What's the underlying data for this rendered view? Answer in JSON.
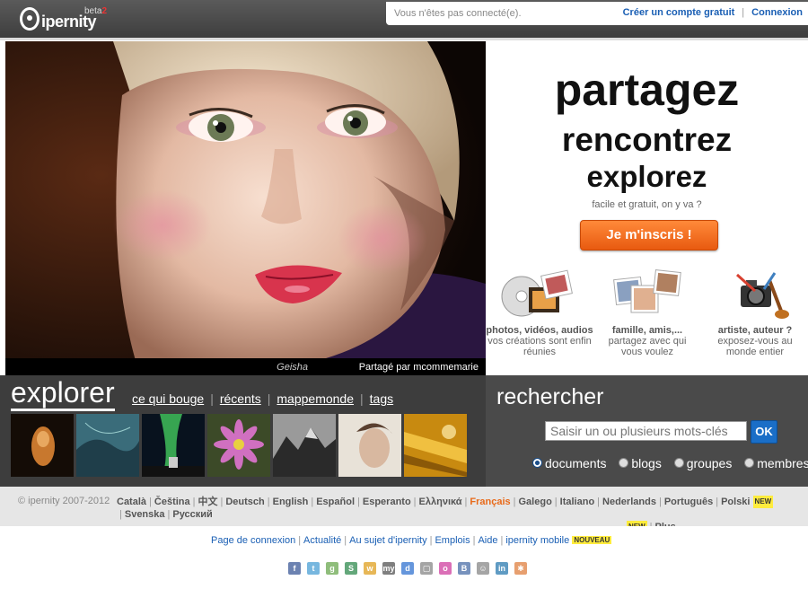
{
  "header": {
    "logo_text": "ipernity",
    "beta_text": "beta",
    "beta_num": "2",
    "status": "Vous n'êtes pas connecté(e).",
    "create_account": "Créer un compte gratuit",
    "separator": "|",
    "login": "Connexion"
  },
  "hero": {
    "photo_title": "Geisha",
    "shared_by": "Partagé par mcommemarie"
  },
  "promo": {
    "line1": "partagez",
    "line2": "rencontrez",
    "line3": "explorez",
    "tagline": "facile et gratuit, on y va ?",
    "signup_button": "Je m'inscris !",
    "features": [
      {
        "title": "photos, vidéos, audios",
        "desc1": "vos créations sont enfin",
        "desc2": "réunies"
      },
      {
        "title": "famille, amis,...",
        "desc1": "partagez avec qui",
        "desc2": "vous voulez"
      },
      {
        "title": "artiste, auteur ?",
        "desc1": "exposez-vous au",
        "desc2": "monde entier"
      }
    ]
  },
  "explorer": {
    "title": "explorer",
    "links": [
      "ce qui bouge",
      "récents",
      "mappemonde",
      "tags"
    ],
    "sep": "|"
  },
  "search": {
    "title": "rechercher",
    "placeholder": "Saisir un ou plusieurs mots-clés",
    "ok": "OK",
    "options": [
      "documents",
      "blogs",
      "groupes",
      "membres"
    ],
    "selected": "documents"
  },
  "languages": {
    "copyright": "© ipernity 2007-2012",
    "list": [
      "Català",
      "Čeština",
      "中文",
      "Deutsch",
      "English",
      "Español",
      "Esperanto",
      "Ελληνικά",
      "Français",
      "Galego",
      "Italiano",
      "Nederlands",
      "Português",
      "Polski",
      "Svenska",
      "Русский",
      "Plus..."
    ],
    "active": "Français",
    "new_badge": "NEW"
  },
  "footer": {
    "links": [
      "Page de connexion",
      "Actualité",
      "Au sujet d'ipernity",
      "Emplois",
      "Aide",
      "ipernity mobile"
    ],
    "new_badge": "NOUVEAU",
    "sep": "|"
  },
  "colors": {
    "topbar": "#4a4a4a",
    "accent_orange": "#e85a10",
    "link_blue": "#1a5fb4",
    "search_ok": "#1a6ec7"
  },
  "social_icons": [
    "facebook-icon",
    "twitter-icon",
    "google-icon",
    "stumbleupon-icon",
    "windows-icon",
    "myspace-icon",
    "delicious-icon",
    "digg-icon",
    "flickr-icon",
    "blogger-icon",
    "reddit-icon",
    "linkedin-icon",
    "misc-icon"
  ]
}
